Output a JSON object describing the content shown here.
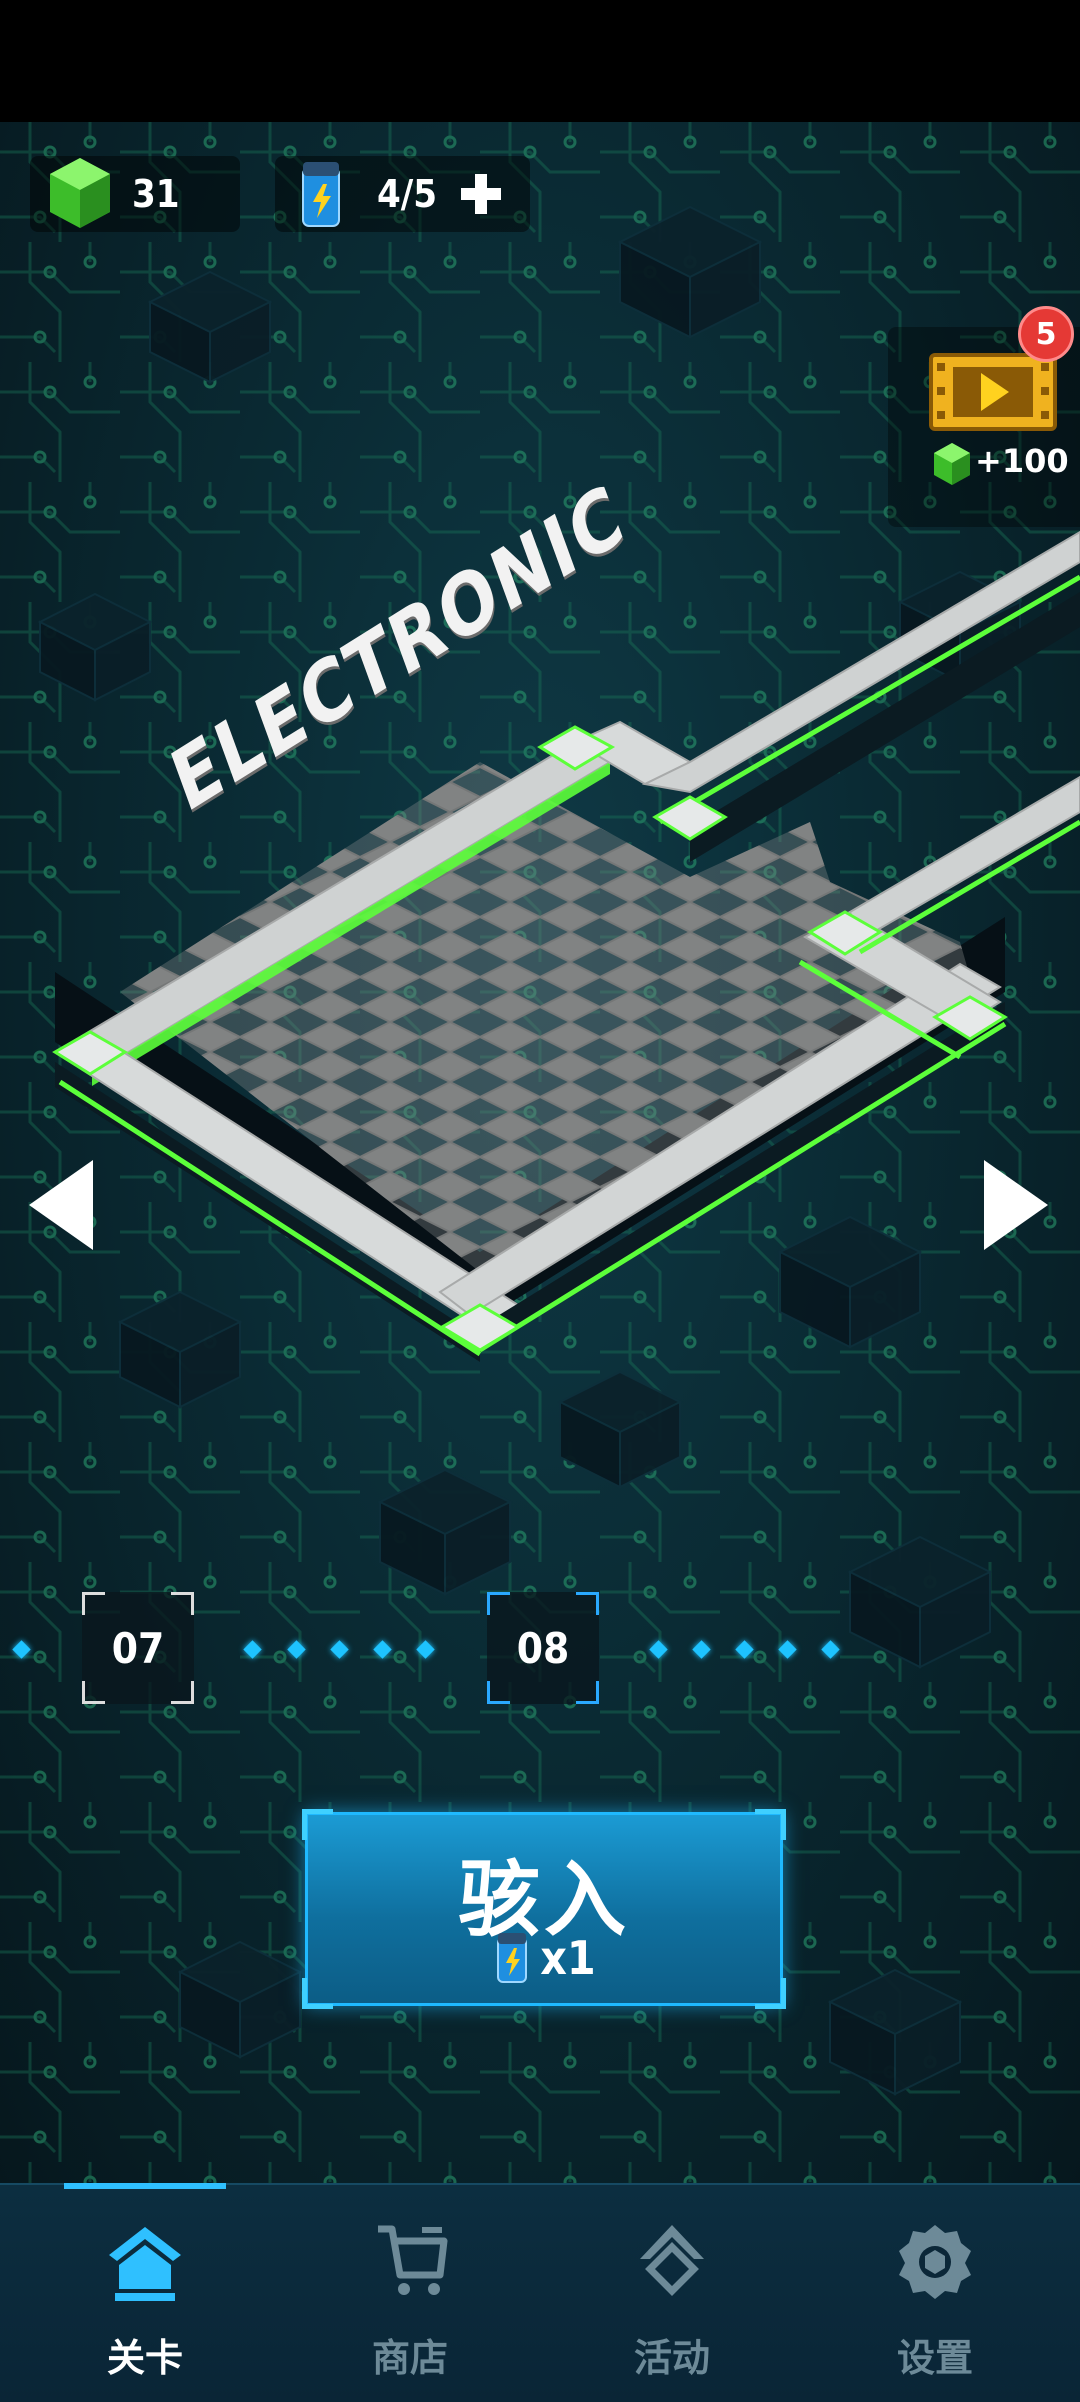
{
  "game": {
    "world_title": "ELECTRONIC"
  },
  "hud": {
    "gems": "31",
    "energy": "4/5",
    "video_reward": {
      "badge_count": "5",
      "reward": "+100"
    }
  },
  "levels": {
    "nodes": [
      {
        "label": "07",
        "state": "unlocked"
      },
      {
        "label": "08",
        "state": "selected"
      }
    ]
  },
  "enter_button": {
    "label": "骇入",
    "cost": "x1"
  },
  "bottom_nav": {
    "tabs": [
      {
        "label": "关卡",
        "icon": "home-icon",
        "active": true
      },
      {
        "label": "商店",
        "icon": "cart-icon",
        "active": false
      },
      {
        "label": "活动",
        "icon": "activity-icon",
        "active": false
      },
      {
        "label": "设置",
        "icon": "gear-icon",
        "active": false
      }
    ]
  },
  "colors": {
    "accent": "#2fc0ff",
    "neon_green": "#5cff3a",
    "gem_green": "#4cd134",
    "badge_red": "#e53935",
    "inactive_tab": "#6d8a98"
  }
}
